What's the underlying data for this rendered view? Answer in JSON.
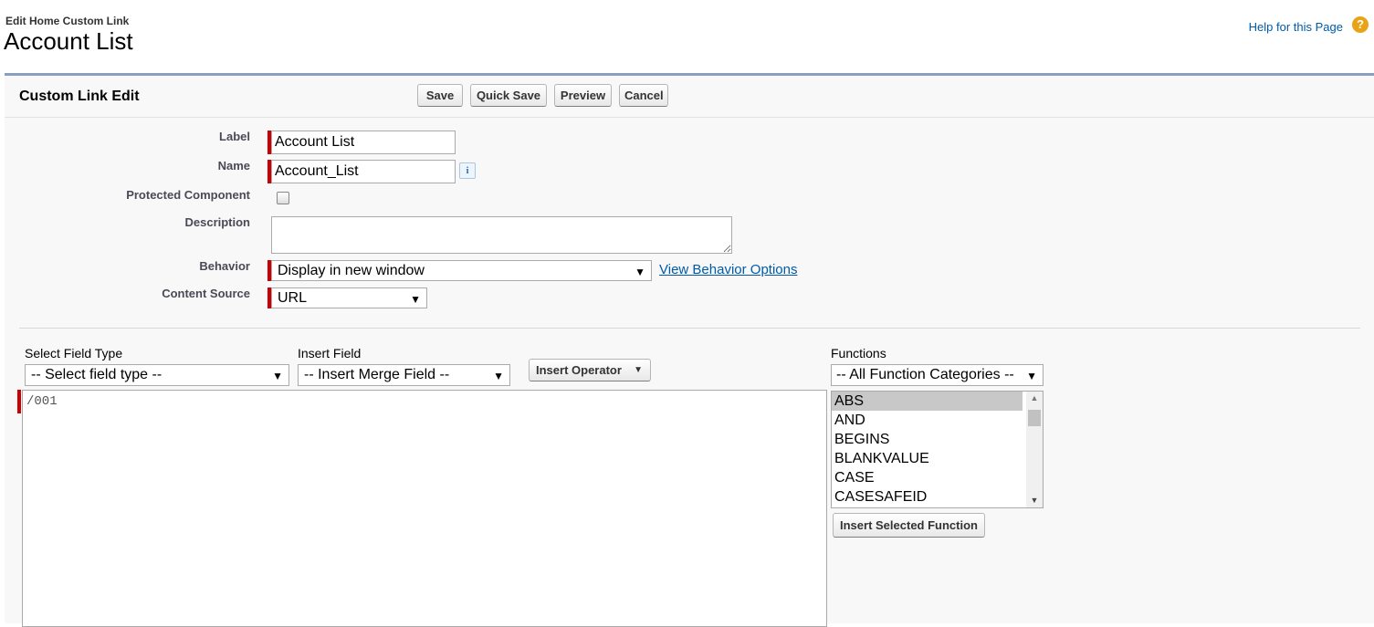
{
  "header": {
    "subtitle": "Edit Home Custom Link",
    "title": "Account List",
    "help_link": "Help for this Page",
    "help_icon": "?"
  },
  "section": {
    "title": "Custom Link Edit",
    "buttons": {
      "save": "Save",
      "quick_save": "Quick Save",
      "preview": "Preview",
      "cancel": "Cancel"
    }
  },
  "form": {
    "label": {
      "label": "Label",
      "value": "Account List"
    },
    "name": {
      "label": "Name",
      "value": "Account_List",
      "info_icon": "i"
    },
    "protected": {
      "label": "Protected Component",
      "checked": false
    },
    "description": {
      "label": "Description",
      "value": ""
    },
    "behavior": {
      "label": "Behavior",
      "value": "Display in new window",
      "link": "View Behavior Options"
    },
    "content_source": {
      "label": "Content Source",
      "value": "URL"
    }
  },
  "formula": {
    "field_type": {
      "label": "Select Field Type",
      "value": "-- Select field type --"
    },
    "insert_field": {
      "label": "Insert Field",
      "value": "-- Insert Merge Field --"
    },
    "insert_operator": "Insert Operator",
    "editor_text": "/001",
    "functions": {
      "label": "Functions",
      "category": "-- All Function Categories --",
      "items": [
        "ABS",
        "AND",
        "BEGINS",
        "BLANKVALUE",
        "CASE",
        "CASESAFEID"
      ],
      "selected": "ABS",
      "insert_button": "Insert Selected Function"
    }
  },
  "colors": {
    "required": "#cc0000",
    "link": "#015ba7",
    "panel_border": "#8a9ebe",
    "help_icon": "#e8a317"
  }
}
